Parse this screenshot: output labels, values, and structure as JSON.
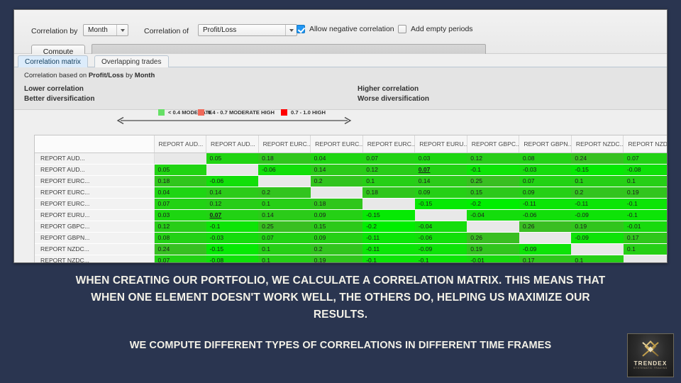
{
  "window": {
    "toolbar": {
      "correlation_by_label": "Correlation by",
      "correlation_by_value": "Month",
      "correlation_of_label": "Correlation of",
      "correlation_of_value": "Profit/Loss",
      "allow_negative_label": "Allow negative correlation",
      "allow_negative_checked": true,
      "add_empty_label": "Add empty periods",
      "add_empty_checked": false,
      "compute_label": "Compute",
      "progress_value": ""
    },
    "tabs": [
      {
        "label": "Correlation matrix",
        "active": true
      },
      {
        "label": "Overlapping trades",
        "active": false
      }
    ],
    "legend": {
      "basis_prefix": "Correlation based on ",
      "basis_metric": "Profit/Loss",
      "basis_mid": " by ",
      "basis_period": "Month",
      "left_line1": "Lower correlation",
      "left_line2": "Better diversification",
      "right_line1": "Higher correlation",
      "right_line2": "Worse diversification",
      "swatches": [
        {
          "label": "< 0.4 MODERATE",
          "color": "#66e066"
        },
        {
          "label": "0.4 - 0.7 MODERATE HIGH",
          "color": "#f06a5a"
        },
        {
          "label": "0.7 - 1.0 HIGH",
          "color": "#ff0000"
        }
      ]
    }
  },
  "chart_data": {
    "type": "heatmap",
    "title": "Correlation matrix",
    "subtitle": "Correlation based on Profit/Loss by Month",
    "xlabel": "",
    "ylabel": "",
    "corner_header": "",
    "columns": [
      "REPORT AUD...",
      "REPORT AUD...",
      "REPORT EURC...",
      "REPORT EURC...",
      "REPORT EURC...",
      "REPORT EURU...",
      "REPORT GBPC...",
      "REPORT GBPN...",
      "REPORT NZDC...",
      "REPORT NZDC..."
    ],
    "rows": [
      "REPORT AUD...",
      "REPORT AUD...",
      "REPORT EURC...",
      "REPORT EURC...",
      "REPORT EURC...",
      "REPORT EURU...",
      "REPORT GBPC...",
      "REPORT GBPN...",
      "REPORT NZDC...",
      "REPORT NZDC..."
    ],
    "values": [
      [
        null,
        0.05,
        0.18,
        0.04,
        0.07,
        0.03,
        0.12,
        0.08,
        0.24,
        0.07
      ],
      [
        0.05,
        null,
        -0.06,
        0.14,
        0.12,
        0.07,
        -0.1,
        -0.03,
        -0.15,
        -0.08
      ],
      [
        0.18,
        -0.06,
        null,
        0.2,
        0.1,
        0.14,
        0.25,
        0.07,
        0.1,
        0.1
      ],
      [
        0.04,
        0.14,
        0.2,
        null,
        0.18,
        0.09,
        0.15,
        0.09,
        0.2,
        0.19
      ],
      [
        0.07,
        0.12,
        0.1,
        0.18,
        null,
        -0.15,
        -0.2,
        -0.11,
        -0.11,
        -0.1
      ],
      [
        0.03,
        0.07,
        0.14,
        0.09,
        -0.15,
        null,
        -0.04,
        -0.06,
        -0.09,
        -0.1
      ],
      [
        0.12,
        -0.1,
        0.25,
        0.15,
        -0.2,
        -0.04,
        null,
        0.26,
        0.19,
        -0.01
      ],
      [
        0.08,
        -0.03,
        0.07,
        0.09,
        -0.11,
        -0.06,
        0.26,
        null,
        -0.09,
        0.17
      ],
      [
        0.24,
        -0.15,
        0.1,
        0.2,
        -0.11,
        -0.09,
        0.19,
        -0.09,
        null,
        0.1
      ],
      [
        0.07,
        -0.08,
        0.1,
        0.19,
        -0.1,
        -0.1,
        -0.01,
        0.17,
        0.1,
        null
      ]
    ],
    "display": [
      [
        "",
        "0.05",
        "0.18",
        "0.04",
        "0.07",
        "0.03",
        "0.12",
        "0.08",
        "0.24",
        "0.07"
      ],
      [
        "0.05",
        "",
        "-0.06",
        "0.14",
        "0.12",
        "0.07",
        "-0.1",
        "-0.03",
        "-0.15",
        "-0.08"
      ],
      [
        "0.18",
        "-0.06",
        "",
        "0.2",
        "0.1",
        "0.14",
        "0.25",
        "0.07",
        "0.1",
        "0.1"
      ],
      [
        "0.04",
        "0.14",
        "0.2",
        "",
        "0.18",
        "0.09",
        "0.15",
        "0.09",
        "0.2",
        "0.19"
      ],
      [
        "0.07",
        "0.12",
        "0.1",
        "0.18",
        "",
        "-0.15",
        "-0.2",
        "-0.11",
        "-0.11",
        "-0.1"
      ],
      [
        "0.03",
        "0.07",
        "0.14",
        "0.09",
        "-0.15",
        "",
        "-0.04",
        "-0.06",
        "-0.09",
        "-0.1"
      ],
      [
        "0.12",
        "-0.1",
        "0.25",
        "0.15",
        "-0.2",
        "-0.04",
        "",
        "0.26",
        "0.19",
        "-0.01"
      ],
      [
        "0.08",
        "-0.03",
        "0.07",
        "0.09",
        "-0.11",
        "-0.06",
        "0.26",
        "",
        "-0.09",
        "0.17"
      ],
      [
        "0.24",
        "-0.15",
        "0.1",
        "0.2",
        "-0.11",
        "-0.09",
        "0.19",
        "-0.09",
        "",
        "0.1"
      ],
      [
        "0.07",
        "-0.08",
        "0.1",
        "0.19",
        "-0.1",
        "-0.1",
        "-0.01",
        "0.17",
        "0.1",
        ""
      ]
    ],
    "highlighted": [
      [
        1,
        5
      ],
      [
        5,
        1
      ]
    ],
    "colorscale": {
      "low": "#00ee00",
      "high": "#33bb22",
      "empty": "#e8e8e8",
      "range": [
        -0.2,
        0.26
      ]
    },
    "legend_position": "top"
  },
  "caption": {
    "main": "WHEN CREATING OUR PORTFOLIO, WE CALCULATE A CORRELATION MATRIX. THIS MEANS THAT WHEN ONE ELEMENT DOESN'T WORK WELL, THE OTHERS DO, HELPING US MAXIMIZE OUR RESULTS.",
    "sub": "WE COMPUTE DIFFERENT TYPES OF CORRELATIONS IN DIFFERENT TIME FRAMES"
  },
  "logo": {
    "name": "TRENDEX",
    "tagline": "SYSTEMATIC TRADING"
  }
}
